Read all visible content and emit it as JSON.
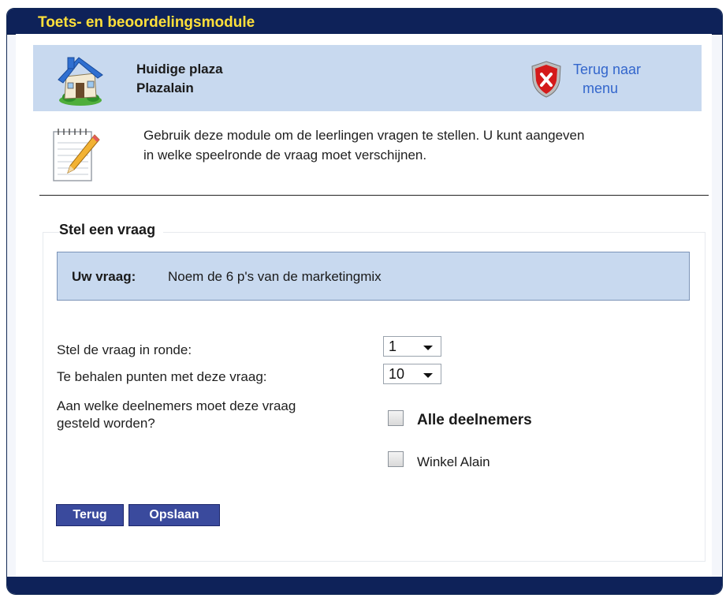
{
  "window": {
    "title": "Toets- en beoordelingsmodule"
  },
  "plaza": {
    "label": "Huidige plaza",
    "name": "Plazalain",
    "back_link_line1": "Terug naar",
    "back_link_line2": "menu"
  },
  "intro": {
    "line1": "Gebruik deze module om de leerlingen vragen te stellen. U kunt aangeven",
    "line2": "in welke speelronde de vraag moet verschijnen."
  },
  "form": {
    "legend": "Stel een vraag",
    "question_label": "Uw vraag:",
    "question_text": "Noem de 6 p's van de marketingmix",
    "round_label": "Stel de vraag in ronde:",
    "round_value": "1",
    "points_label": "Te behalen punten met deze vraag:",
    "points_value": "10",
    "participants_label_line1": "Aan welke deelnemers moet deze vraag",
    "participants_label_line2": "gesteld worden?",
    "participants": [
      {
        "label": "Alle deelnemers",
        "checked": false
      },
      {
        "label": "Winkel Alain",
        "checked": false
      }
    ]
  },
  "buttons": {
    "back": "Terug",
    "save": "Opslaan"
  },
  "colors": {
    "titlebar": "#0e2259",
    "title_text": "#ffe03a",
    "highlight_panel": "#c8d9ef",
    "link": "#3366cc",
    "button": "#3a4a9d"
  },
  "icons": {
    "house": "house-icon",
    "shield": "shield-x-icon",
    "notepad": "notepad-pencil-icon",
    "caret": "caret-down-icon"
  }
}
